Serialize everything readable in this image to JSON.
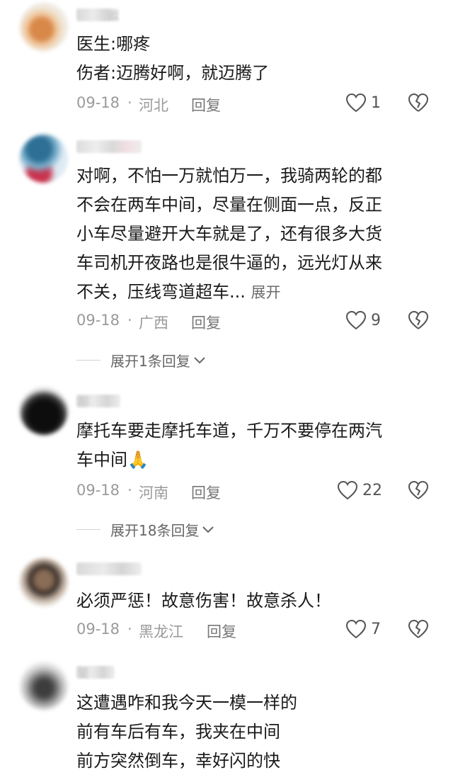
{
  "comments": [
    {
      "username": "姒",
      "avatar_colors": [
        "#efe9df",
        "#d8894a",
        "#2f2f2f"
      ],
      "lines": [
        "医生:哪疼",
        "伤者:迈腾好啊，就迈腾了"
      ],
      "date": "09-18",
      "region": "河北",
      "reply_label": "回复",
      "likes": "1"
    },
    {
      "username": "",
      "avatar_colors": [
        "#dfeaf3",
        "#2d6f95",
        "#c8334e"
      ],
      "lines": [
        "对啊，不怕一万就怕万一，我骑两轮的都",
        "不会在两车中间，尽量在侧面一点，反正",
        "小车尽量避开大车就是了，还有很多大货",
        "车司机开夜路也是很牛逼的，远光灯从来",
        "不关，压线弯道超车..."
      ],
      "more_label": "展开",
      "date": "09-18",
      "region": "广西",
      "reply_label": "回复",
      "likes": "9",
      "expand_label": "展开1条回复"
    },
    {
      "username": "那",
      "avatar_colors": [
        "#e9e9e9",
        "#181818",
        "#0d0d0d"
      ],
      "lines": [
        "摩托车要走摩托车道，千万不要停在两汽",
        "车中间🙏"
      ],
      "date": "09-18",
      "region": "河南",
      "reply_label": "回复",
      "likes": "22",
      "expand_label": "展开18条回复"
    },
    {
      "username": "",
      "avatar_colors": [
        "#e9e3dc",
        "#8a6d57",
        "#3a2f2a"
      ],
      "lines": [
        "必须严惩！故意伤害！故意杀人！"
      ],
      "date": "09-18",
      "region": "黑龙江",
      "reply_label": "回复",
      "likes": "7"
    },
    {
      "username": "爱",
      "avatar_colors": [
        "#ececec",
        "#6f6f6f",
        "#3d3d3d"
      ],
      "lines": [
        "这遭遇咋和我今天一模一样的",
        "前有车后有车，我夹在中间",
        "前方突然倒车，幸好闪的快"
      ]
    }
  ]
}
